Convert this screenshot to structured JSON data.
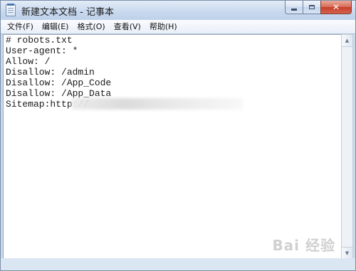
{
  "window": {
    "title": "新建文本文档 - 记事本",
    "close_symbol": "✕"
  },
  "menu": {
    "items": [
      {
        "label": "文件(F)"
      },
      {
        "label": "编辑(E)"
      },
      {
        "label": "格式(O)"
      },
      {
        "label": "查看(V)"
      },
      {
        "label": "帮助(H)"
      }
    ]
  },
  "document": {
    "lines": [
      "# robots.txt",
      "User-agent: *",
      "Allow: /",
      "Disallow: /admin",
      "Disallow: /App_Code",
      "Disallow: /App_Data",
      "Sitemap:http://"
    ]
  },
  "scrollbar": {
    "up_arrow": "▲",
    "down_arrow": "▼"
  },
  "watermark": {
    "text": "Bai 经验"
  }
}
